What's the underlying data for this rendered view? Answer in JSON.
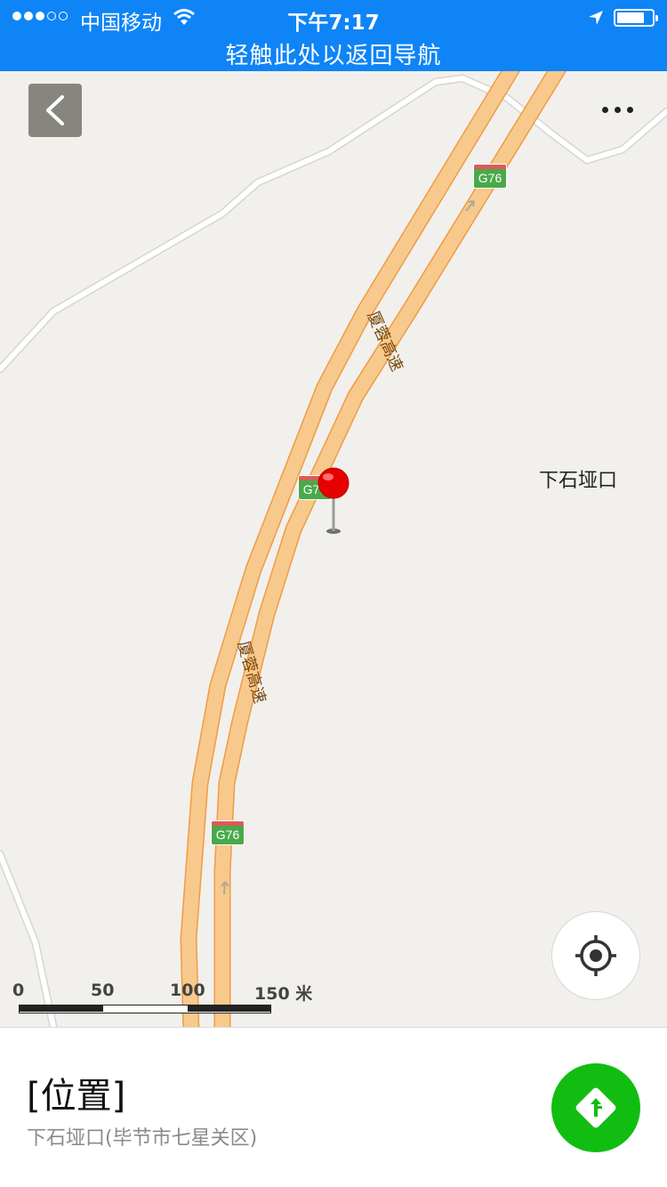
{
  "status_bar": {
    "signal_dots": [
      true,
      true,
      true,
      false,
      false
    ],
    "carrier": "中国移动",
    "time": "下午7:17",
    "return_to_nav": "轻触此处以返回导航",
    "background_color": "#0e84f6",
    "icons": [
      "wifi-icon",
      "location-arrow-icon",
      "battery-icon"
    ]
  },
  "map": {
    "background_color": "#f2f0ed",
    "road_color": "#f8c98c",
    "shield_color": "#4aa94a",
    "road_name": "厦蓉高速",
    "route_shields": [
      "G76",
      "G76",
      "G76"
    ],
    "place_name": "下石垭口",
    "pin_color": "#e60000",
    "scale": {
      "ticks": [
        "0",
        "50",
        "100",
        "150 米"
      ]
    },
    "icons": [
      "back-arrow-icon",
      "more-dots-icon",
      "locate-icon",
      "map-pin-icon"
    ]
  },
  "location_panel": {
    "title": "[位置]",
    "address": "下石垭口(毕节市七星关区)",
    "nav_button_color": "#12bd12",
    "icons": [
      "navigate-icon"
    ]
  }
}
